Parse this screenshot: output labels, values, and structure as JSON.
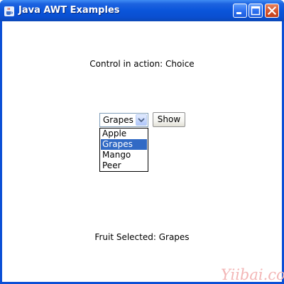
{
  "window": {
    "title": "Java AWT Examples"
  },
  "main": {
    "heading": "Control in action: Choice",
    "choice": {
      "selected": "Grapes",
      "options": [
        "Apple",
        "Grapes",
        "Mango",
        "Peer"
      ],
      "highlighted_index": 1
    },
    "show_button_label": "Show",
    "status_text": "Fruit Selected: Grapes"
  },
  "watermark": {
    "text": "Yiibai.com"
  },
  "colors": {
    "titlebar": "#0a55da",
    "selection": "#316ac5",
    "close_button": "#d4532c",
    "watermark": "#f3b6b6"
  },
  "icons": {
    "app": "java-cup-icon",
    "minimize": "minimize-icon",
    "maximize": "maximize-icon",
    "close": "close-icon",
    "dropdown": "chevron-down-icon"
  }
}
